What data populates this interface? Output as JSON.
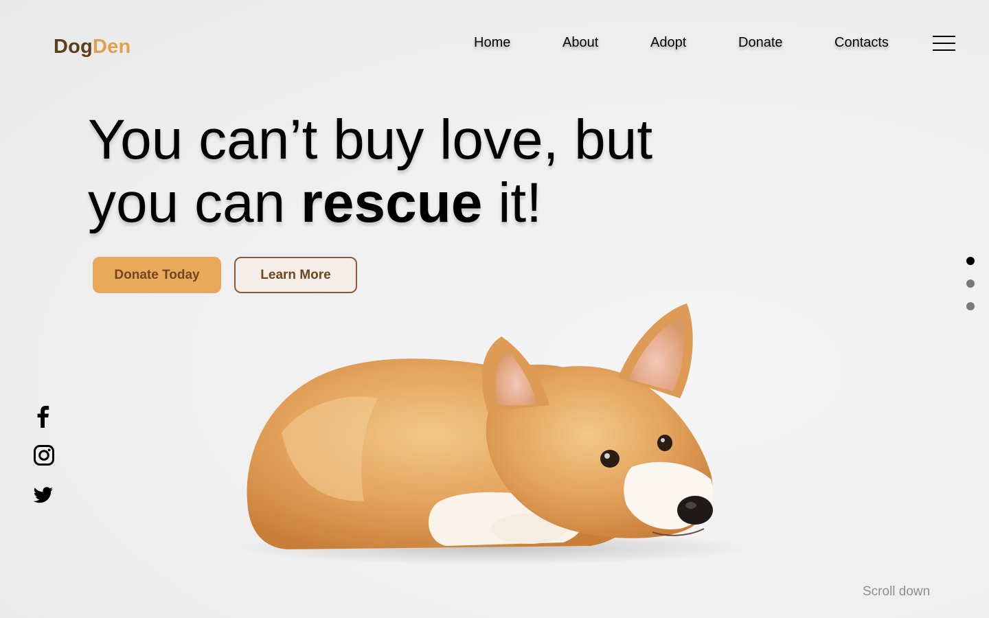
{
  "brand": {
    "part1": "Dog",
    "part2": "Den",
    "color_dark": "#5c3d1e",
    "color_accent": "#e0a04f"
  },
  "nav": {
    "items": [
      {
        "label": "Home"
      },
      {
        "label": "About"
      },
      {
        "label": "Adopt"
      },
      {
        "label": "Donate"
      },
      {
        "label": "Contacts"
      }
    ],
    "menu_icon": "hamburger-menu-icon"
  },
  "hero": {
    "line1": "You can’t buy love, but",
    "line2_pre": "you can ",
    "line2_bold": "rescue",
    "line2_post": " it!",
    "primary_button": "Donate Today",
    "secondary_button": "Learn More",
    "image": "corgi-dog-lying-image"
  },
  "pager": {
    "count": 3,
    "active_index": 0,
    "active_color": "#000000",
    "inactive_color": "#7a7a7a"
  },
  "social": [
    "facebook-icon",
    "instagram-icon",
    "twitter-icon"
  ],
  "scroll_hint": "Scroll down",
  "colors": {
    "primary_button": "#e9a95b",
    "button_text": "#6e4620",
    "secondary_border": "#8a5a3a"
  }
}
